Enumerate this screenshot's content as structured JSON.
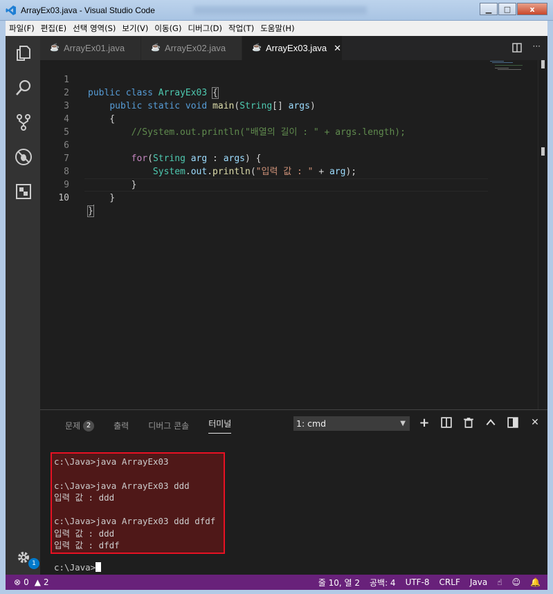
{
  "window": {
    "title": "ArrayEx03.java - Visual Studio Code",
    "buttons": {
      "minimize": "▁",
      "maximize": "□",
      "close": "x"
    }
  },
  "menu": [
    "파일(F)",
    "편집(E)",
    "선택 영역(S)",
    "보기(V)",
    "이동(G)",
    "디버그(D)",
    "작업(T)",
    "도움말(H)"
  ],
  "activity_bar": {
    "icons": [
      "explorer-icon",
      "search-icon",
      "source-control-icon",
      "debug-icon",
      "extensions-icon",
      "settings-gear-icon"
    ],
    "settings_badge": "1"
  },
  "tabs": [
    {
      "label": "ArrayEx01.java",
      "icon": "java-icon",
      "active": false
    },
    {
      "label": "ArrayEx02.java",
      "icon": "java-icon",
      "active": false
    },
    {
      "label": "ArrayEx03.java",
      "icon": "java-icon",
      "active": true,
      "close": "✕"
    }
  ],
  "editor": {
    "line_numbers": [
      "1",
      "2",
      "3",
      "4",
      "5",
      "6",
      "7",
      "8",
      "9",
      "10"
    ],
    "current_line": 10
  },
  "panel": {
    "tabs": [
      {
        "label": "문제",
        "badge": "2"
      },
      {
        "label": "출력"
      },
      {
        "label": "디버그 콘솔"
      },
      {
        "label": "터미널",
        "active": true
      }
    ],
    "terminal_select": "1: cmd",
    "terminal_lines": [
      "c:\\Java>java ArrayEx03",
      "",
      "c:\\Java>java ArrayEx03 ddd",
      "입력 값 : ddd",
      "",
      "c:\\Java>java ArrayEx03 ddd dfdf",
      "입력 값 : ddd",
      "입력 값 : dfdf"
    ],
    "prompt": "c:\\Java>",
    "highlight_color": "#e81123"
  },
  "status_bar": {
    "errors": "0",
    "warnings": "2",
    "position": "줄 10, 열 2",
    "spaces": "공백: 4",
    "encoding": "UTF-8",
    "eol": "CRLF",
    "language": "Java",
    "background": "#68217a"
  }
}
